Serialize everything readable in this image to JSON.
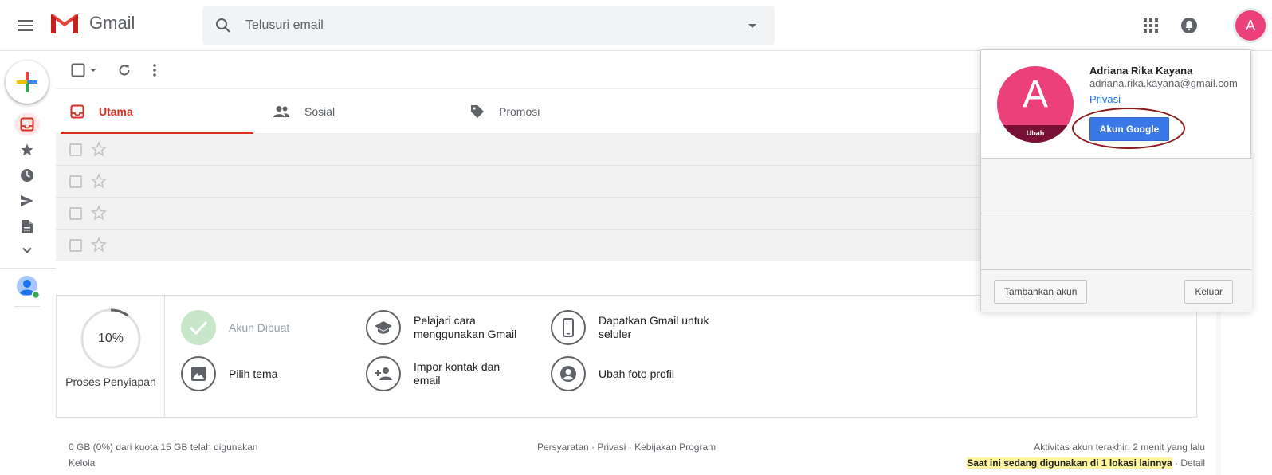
{
  "header": {
    "app_name": "Gmail",
    "search_placeholder": "Telusuri email",
    "avatar_letter": "A"
  },
  "tabs": [
    {
      "label": "Utama",
      "active": true
    },
    {
      "label": "Sosial",
      "active": false
    },
    {
      "label": "Promosi",
      "active": false
    }
  ],
  "setup": {
    "progress_value": "10%",
    "progress_fraction": 0.1,
    "progress_label": "Proses Penyiapan",
    "tasks": [
      {
        "label": "Akun Dibuat",
        "done": true,
        "icon": "check-icon"
      },
      {
        "label": "Pelajari cara menggunakan Gmail",
        "done": false,
        "icon": "school-icon"
      },
      {
        "label": "Dapatkan Gmail untuk seluler",
        "done": false,
        "icon": "phone-icon"
      },
      {
        "label": "Pilih tema",
        "done": false,
        "icon": "image-icon"
      },
      {
        "label": "Impor kontak dan email",
        "done": false,
        "icon": "person-add-icon"
      },
      {
        "label": "Ubah foto profil",
        "done": false,
        "icon": "account-circle-icon"
      }
    ]
  },
  "footer": {
    "storage": "0 GB (0%) dari kuota 15 GB telah digunakan",
    "manage": "Kelola",
    "terms": "Persyaratan",
    "privacy": "Privasi",
    "program": "Kebijakan Program",
    "sep": " · ",
    "activity": "Aktivitas akun terakhir: 2 menit yang lalu",
    "in_use": "Saat ini sedang digunakan di 1 lokasi lainnya",
    "detail": "Detail"
  },
  "account_popup": {
    "avatar_letter": "A",
    "change_label": "Ubah",
    "name": "Adriana Rika Kayana",
    "email": "adriana.rika.kayana@gmail.com",
    "privacy": "Privasi",
    "google_account_button": "Akun Google",
    "add_account_button": "Tambahkan akun",
    "sign_out_button": "Keluar"
  },
  "colors": {
    "accent_red": "#d93025",
    "avatar_pink": "#ec407a",
    "button_blue": "#3b78e7",
    "link_blue": "#1a73e8"
  }
}
